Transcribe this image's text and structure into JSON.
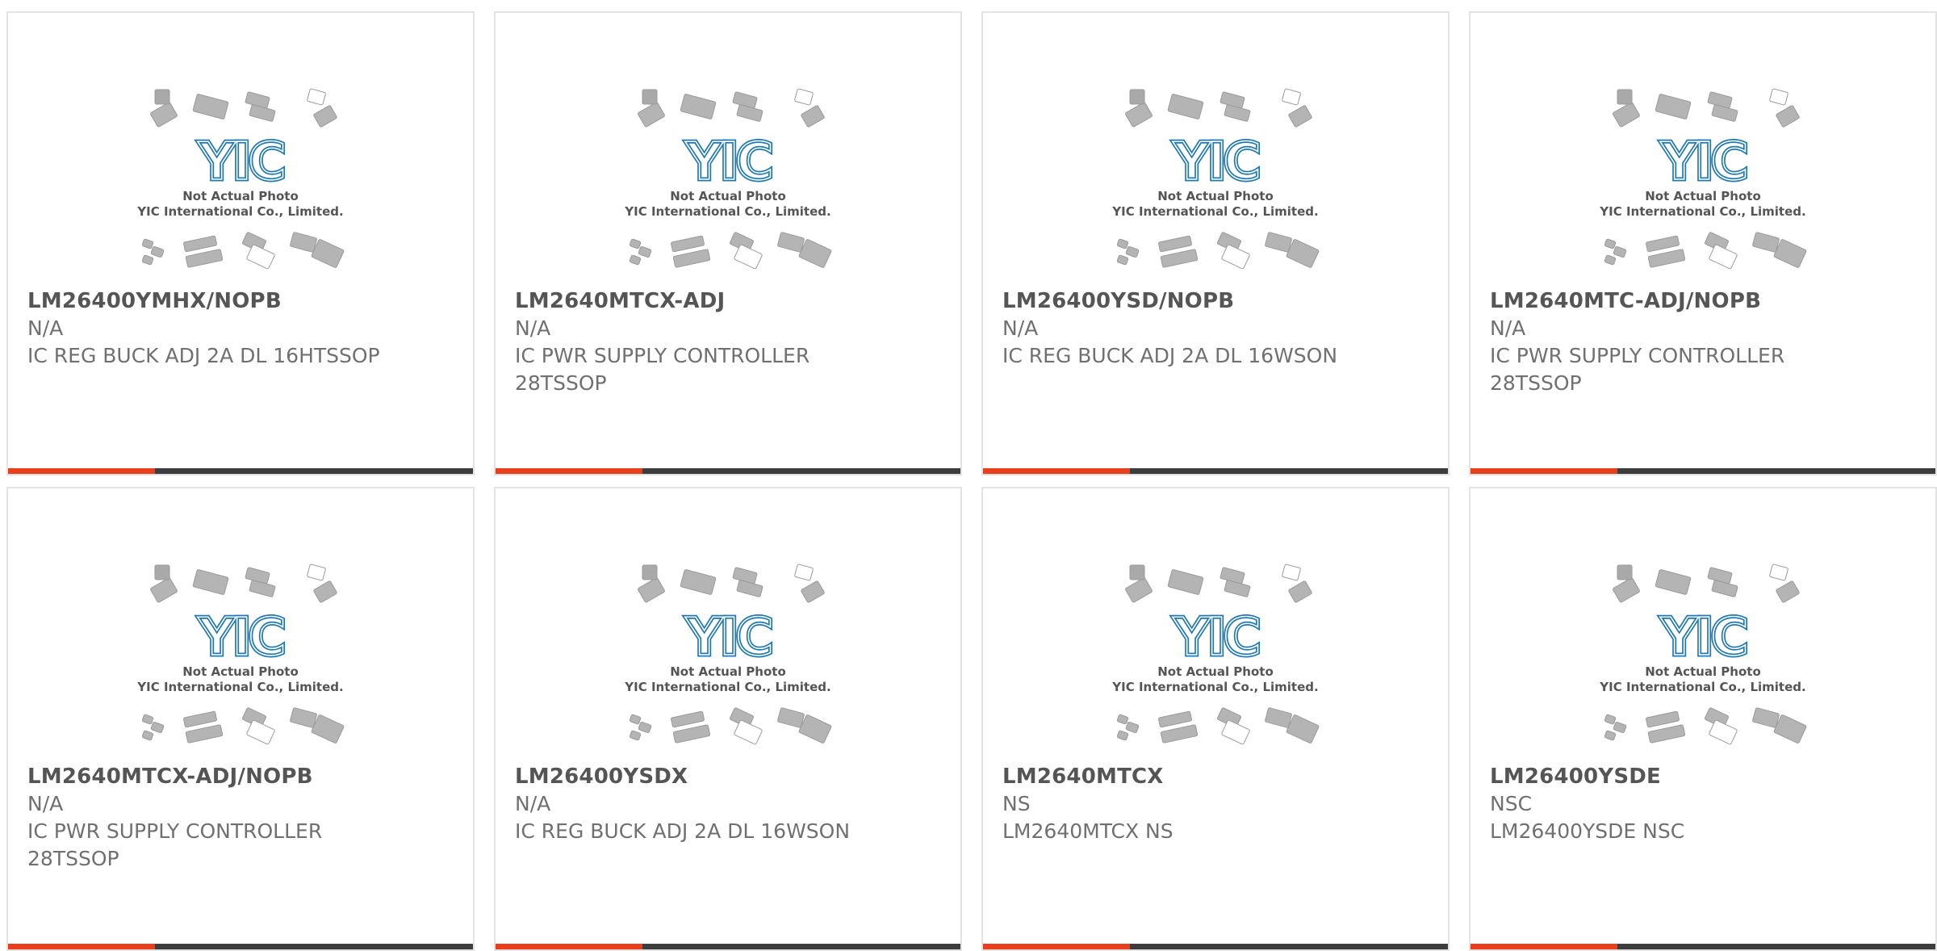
{
  "placeholder": {
    "logo_text": "YIC",
    "line1": "Not Actual Photo",
    "line2": "YIC International Co., Limited."
  },
  "colors": {
    "accent": "#e8401c",
    "bar": "#3d3d3d",
    "logo": "#1e78b4",
    "chip": "#b4b4b4"
  },
  "products": [
    {
      "part": "LM26400YMHX/NOPB",
      "manufacturer": "N/A",
      "description": "IC REG BUCK ADJ 2A DL 16HTSSOP"
    },
    {
      "part": "LM2640MTCX-ADJ",
      "manufacturer": "N/A",
      "description": "IC PWR SUPPLY CONTROLLER 28TSSOP"
    },
    {
      "part": "LM26400YSD/NOPB",
      "manufacturer": "N/A",
      "description": "IC REG BUCK ADJ 2A DL 16WSON"
    },
    {
      "part": "LM2640MTC-ADJ/NOPB",
      "manufacturer": "N/A",
      "description": "IC PWR SUPPLY CONTROLLER 28TSSOP"
    },
    {
      "part": "LM2640MTCX-ADJ/NOPB",
      "manufacturer": "N/A",
      "description": "IC PWR SUPPLY CONTROLLER 28TSSOP"
    },
    {
      "part": "LM26400YSDX",
      "manufacturer": "N/A",
      "description": "IC REG BUCK ADJ 2A DL 16WSON"
    },
    {
      "part": "LM2640MTCX",
      "manufacturer": "NS",
      "description": "LM2640MTCX NS"
    },
    {
      "part": "LM26400YSDE",
      "manufacturer": "NSC",
      "description": "LM26400YSDE NSC"
    }
  ]
}
